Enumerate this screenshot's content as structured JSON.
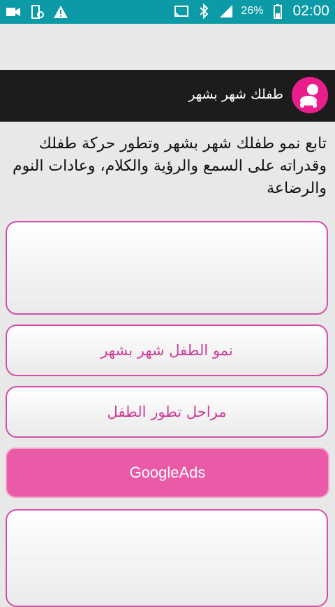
{
  "status_bar": {
    "icons_left": [
      "video-camera-icon",
      "phone-sync-icon",
      "warning-icon"
    ],
    "icons_right": [
      "cast-icon",
      "bluetooth-icon",
      "signal-icon",
      "battery-icon"
    ],
    "battery_percent": "26%",
    "time": "02:00",
    "color": "#0c9aa6"
  },
  "app_bar": {
    "title": "طفلك شهر بشهر",
    "logo_icon": "baby-logo-icon",
    "color": "#1c1c1c"
  },
  "intro_text": "تابع نمو طفلك شهر بشهر وتطور حركة طفلك وقدراته على السمع والرؤية والكلام، وعادات النوم والرضاعة",
  "buttons": {
    "growth_month_by_month": "نمو الطفل شهر بشهر",
    "development_stages": "مراحل تطور الطفل",
    "google_ads": "GoogleAds"
  },
  "colors": {
    "accent": "#d44fa6",
    "ads_background": "#ea5aa6"
  }
}
